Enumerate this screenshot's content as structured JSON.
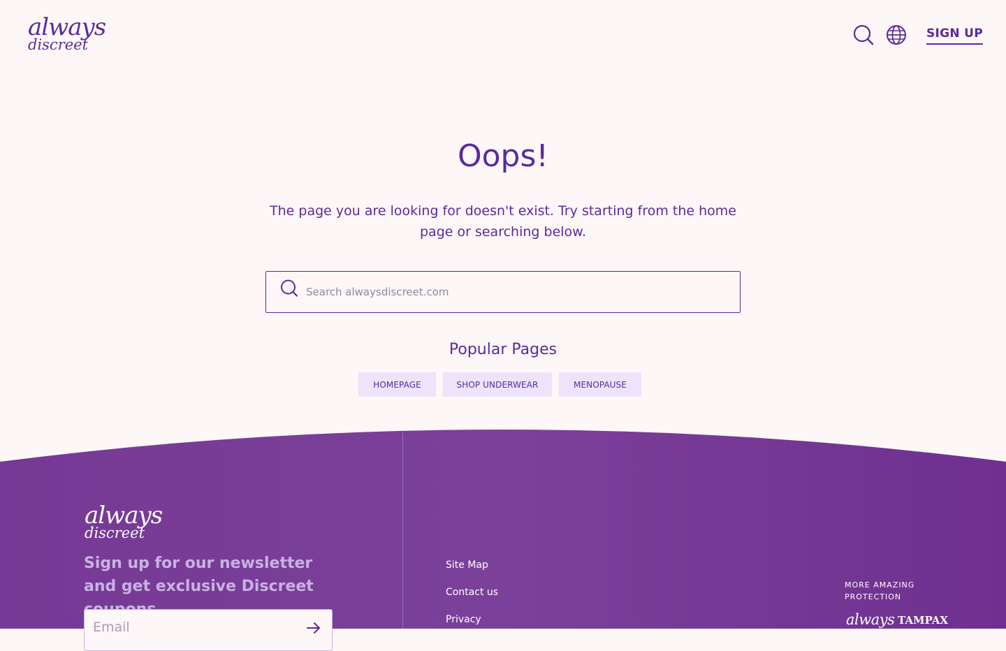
{
  "header": {
    "logo_primary": "always",
    "logo_secondary": "discreet",
    "search_icon": "search-icon",
    "language_icon": "globe-icon",
    "signup_label": "SIGN UP"
  },
  "main": {
    "title": "Oops!",
    "message": "The page you are looking for doesn't exist. Try starting from the home page or searching below.",
    "search_placeholder": "Search alwaysdiscreet.com",
    "search_value": "",
    "popular_title": "Popular Pages",
    "popular_links": [
      "HOMEPAGE",
      "SHOP UNDERWEAR",
      "MENOPAUSE"
    ]
  },
  "footer": {
    "logo_primary": "always",
    "logo_secondary": "discreet",
    "newsletter_text": "Sign up for our newsletter and get exclusive Discreet coupons",
    "email_placeholder": "Email",
    "email_value": "",
    "links": [
      "Site Map",
      "Contact us",
      "Privacy"
    ],
    "more_label": "MORE AMAZING PROTECTION",
    "brands": [
      "always",
      "TAMPAX"
    ]
  },
  "colors": {
    "brand_purple": "#5b2a9b",
    "footer_purple": "#7a3e98",
    "background": "#fdf7f7",
    "pill_bg": "#ede3fb"
  }
}
